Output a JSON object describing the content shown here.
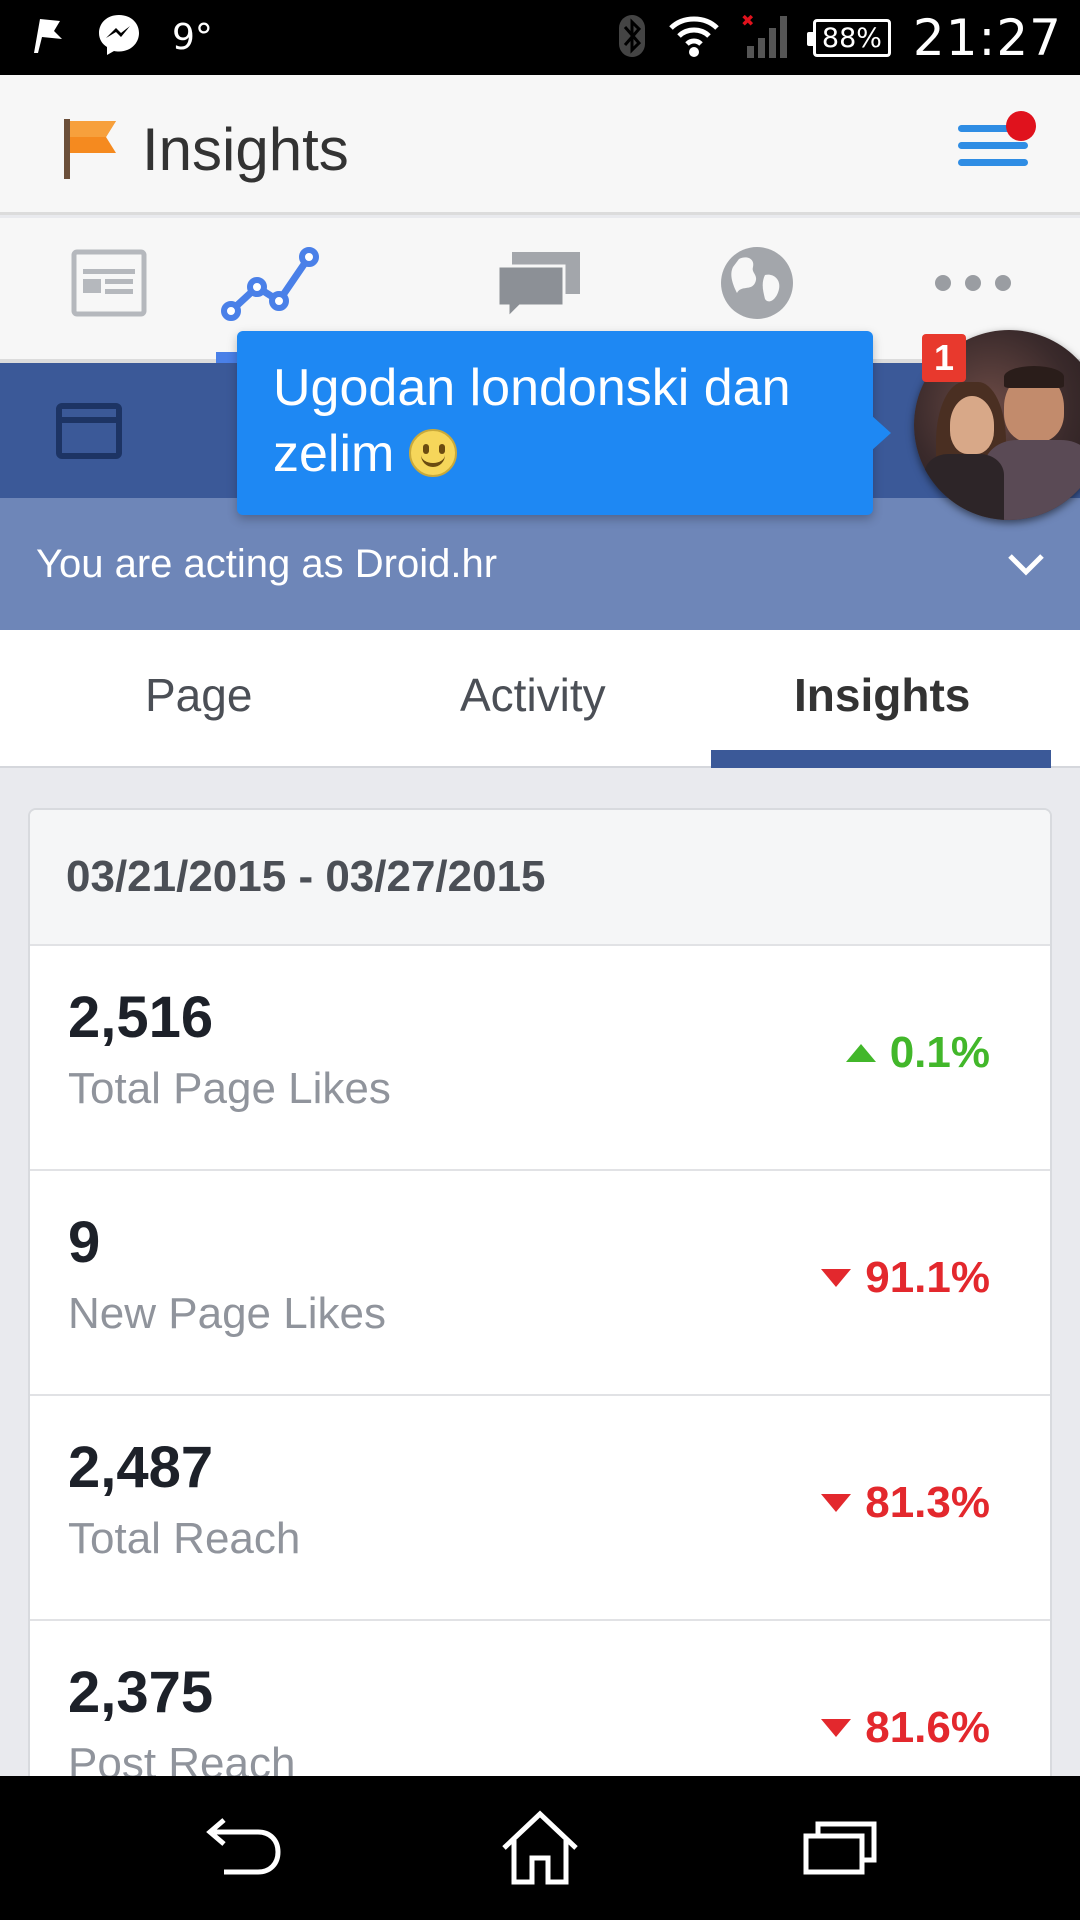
{
  "status_bar": {
    "temperature": "9°",
    "battery": "88%",
    "time": "21:27"
  },
  "header": {
    "title": "Insights"
  },
  "chat_head": {
    "message": "Ugodan londonski dan zelim",
    "badge_count": "1"
  },
  "acting_as": {
    "text": "You are acting as Droid.hr"
  },
  "tabs": [
    {
      "label": "Page"
    },
    {
      "label": "Activity"
    },
    {
      "label": "Insights"
    }
  ],
  "insights": {
    "date_range": "03/21/2015 - 03/27/2015",
    "metrics": [
      {
        "value": "2,516",
        "label": "Total Page Likes",
        "change": "0.1%",
        "direction": "up"
      },
      {
        "value": "9",
        "label": "New Page Likes",
        "change": "91.1%",
        "direction": "down"
      },
      {
        "value": "2,487",
        "label": "Total Reach",
        "change": "81.3%",
        "direction": "down"
      },
      {
        "value": "2,375",
        "label": "Post Reach",
        "change": "81.6%",
        "direction": "down"
      }
    ]
  },
  "colors": {
    "facebook_blue": "#3b5998",
    "acting_bar": "#6e86b8",
    "tooltip_blue": "#1e88f3",
    "positive": "#42b72a",
    "negative": "#e3282d"
  }
}
